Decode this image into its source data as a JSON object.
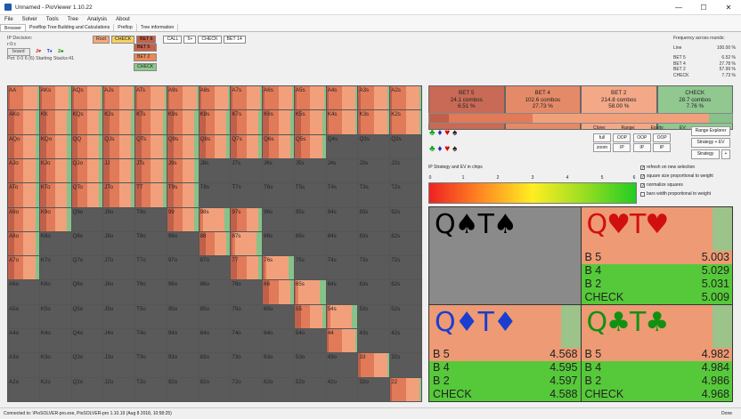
{
  "window": {
    "title": "Unnamed - PioViewer 1.10.22",
    "minimize": "—",
    "maximize": "☐",
    "close": "✕"
  },
  "menu": [
    "File",
    "Solver",
    "Tools",
    "Tree",
    "Analysis",
    "About"
  ],
  "tabs": [
    "Browser",
    "Postflop Tree Building and Calculations",
    "Preflop",
    "Tree information"
  ],
  "left_info": {
    "decision_label": "IP Decision:",
    "line": "r:0:c",
    "board_button": "board",
    "board": [
      "J♥",
      "T♦",
      "2♣"
    ],
    "pot": "Pot: 0 0 6 (6) Starting Stacks:41"
  },
  "action_bar": [
    "Root",
    "CHECK",
    "BET 6",
    "CALL",
    "5+",
    "CHECK",
    "BET 14"
  ],
  "action_sub": [
    "BET 5",
    "BET 2",
    "CHECK"
  ],
  "freq_panel": {
    "title": "Frequency across rounds:",
    "line_label": "Line",
    "line_value": "100.00 %",
    "rows": [
      {
        "k": "BET 5",
        "v": "6.52 %"
      },
      {
        "k": "BET 4",
        "v": "27.78 %"
      },
      {
        "k": "BET 2",
        "v": "57.99 %"
      },
      {
        "k": "CHECK",
        "v": "7.73 %"
      }
    ]
  },
  "grid_labels": [
    [
      "AA",
      "AKs",
      "AQs",
      "AJs",
      "ATs",
      "A9s",
      "A8s",
      "A7s",
      "A6s",
      "A5s",
      "A4s",
      "A3s",
      "A2s"
    ],
    [
      "AKo",
      "KK",
      "KQs",
      "KJs",
      "KTs",
      "K9s",
      "K8s",
      "K7s",
      "K6s",
      "K5s",
      "K4s",
      "K3s",
      "K2s"
    ],
    [
      "AQo",
      "KQo",
      "QQ",
      "QJs",
      "QTs",
      "Q9s",
      "Q8s",
      "Q7s",
      "Q6s",
      "Q5s",
      "Q4s",
      "Q3s",
      "Q2s"
    ],
    [
      "AJo",
      "KJo",
      "QJo",
      "JJ",
      "JTs",
      "J9s",
      "J8s",
      "J7s",
      "J6s",
      "J5s",
      "J4s",
      "J3s",
      "J2s"
    ],
    [
      "ATo",
      "KTo",
      "QTo",
      "JTo",
      "TT",
      "T9s",
      "T8s",
      "T7s",
      "T6s",
      "T5s",
      "T4s",
      "T3s",
      "T2s"
    ],
    [
      "A9o",
      "K9o",
      "Q9o",
      "J9o",
      "T9o",
      "99",
      "98s",
      "97s",
      "96s",
      "95s",
      "94s",
      "93s",
      "92s"
    ],
    [
      "A8o",
      "K8o",
      "Q8o",
      "J8o",
      "T8o",
      "98o",
      "88",
      "87s",
      "86s",
      "85s",
      "84s",
      "83s",
      "82s"
    ],
    [
      "A7o",
      "K7o",
      "Q7o",
      "J7o",
      "T7o",
      "97o",
      "87o",
      "77",
      "76s",
      "75s",
      "74s",
      "73s",
      "72s"
    ],
    [
      "A6o",
      "K6o",
      "Q6o",
      "J6o",
      "T6o",
      "96o",
      "86o",
      "76o",
      "66",
      "65s",
      "64s",
      "63s",
      "62s"
    ],
    [
      "A5o",
      "K5o",
      "Q5o",
      "J5o",
      "T5o",
      "95o",
      "85o",
      "75o",
      "65o",
      "55",
      "54s",
      "53s",
      "52s"
    ],
    [
      "A4o",
      "K4o",
      "Q4o",
      "J4o",
      "T4o",
      "94o",
      "84o",
      "74o",
      "64o",
      "54o",
      "44",
      "43s",
      "42s"
    ],
    [
      "A3o",
      "K3o",
      "Q3o",
      "J3o",
      "T3o",
      "93o",
      "83o",
      "73o",
      "63o",
      "53o",
      "43o",
      "33",
      "32s"
    ],
    [
      "A2o",
      "K2o",
      "Q2o",
      "J2o",
      "T2o",
      "92o",
      "82o",
      "72o",
      "62o",
      "52o",
      "42o",
      "32o",
      "22"
    ]
  ],
  "grid_colors": {
    "bet5": "#c0604a",
    "bet4": "#e07a58",
    "bet2": "#f2a07c",
    "check": "#86c28a",
    "empty": "#5a5a5a"
  },
  "action_cards": [
    {
      "name": "BET 5",
      "combos": "24.1 combos",
      "pct": "6.51 %",
      "color": "#c86a55"
    },
    {
      "name": "BET 4",
      "combos": "102.6 combos",
      "pct": "27.73 %",
      "color": "#e58a68"
    },
    {
      "name": "BET 2",
      "combos": "214.8 combos",
      "pct": "58.00 %",
      "color": "#f3a888"
    },
    {
      "name": "CHECK",
      "combos": "28.7 combos",
      "pct": "7.76 %",
      "color": "#90c890"
    }
  ],
  "strategy_fractions": [
    0.0651,
    0.2773,
    0.58,
    0.0776
  ],
  "controls": {
    "headers": [
      "Clone:",
      "Range:",
      "Equity:",
      "EV:"
    ],
    "buttons_row1": [
      "full",
      "OOP",
      "OOP",
      "OOP"
    ],
    "buttons_row2": [
      "zoom",
      "IP",
      "IP",
      "IP"
    ],
    "range_explorer": "Range Explorer",
    "strategy_ev": "Strategy + EV",
    "strategy": "Strategy",
    "plus": "+",
    "checkboxes": [
      {
        "label": "refresh on new selection",
        "checked": true
      },
      {
        "label": "square size proportional to weight",
        "checked": true
      },
      {
        "label": "normalize squares",
        "checked": true
      },
      {
        "label": "bars width proportional to weight",
        "checked": false
      }
    ]
  },
  "legend_text": "IP Strategy and EV in chips",
  "gradient_ticks": [
    "0",
    "1",
    "2",
    "3",
    "4",
    "5",
    "6"
  ],
  "combos": [
    {
      "title": "Q♠T♠",
      "suit_color": "#000",
      "grey": true,
      "rows": []
    },
    {
      "title": "Q♥T♥",
      "suit_color": "#d01010",
      "grey": false,
      "rows": [
        [
          "B 5",
          "5.003"
        ],
        [
          "B 4",
          "5.029"
        ],
        [
          "B 2",
          "5.031"
        ],
        [
          "CHECK",
          "5.009"
        ]
      ]
    },
    {
      "title": "Q♦T♦",
      "suit_color": "#1a3ed0",
      "grey": false,
      "rows": [
        [
          "B 5",
          "4.568"
        ],
        [
          "B 4",
          "4.595"
        ],
        [
          "B 2",
          "4.597"
        ],
        [
          "CHECK",
          "4.588"
        ]
      ]
    },
    {
      "title": "Q♣T♣",
      "suit_color": "#129012",
      "grey": false,
      "rows": [
        [
          "B 5",
          "4.982"
        ],
        [
          "B 4",
          "4.984"
        ],
        [
          "B 2",
          "4.986"
        ],
        [
          "CHECK",
          "4.968"
        ]
      ]
    }
  ],
  "status": {
    "left": "Connected to: \\PioSOLVER-pro.exe, PioSOLVER-pro 1.10.19 (Aug 8 2018, 10:58:25)",
    "right": "Done"
  }
}
